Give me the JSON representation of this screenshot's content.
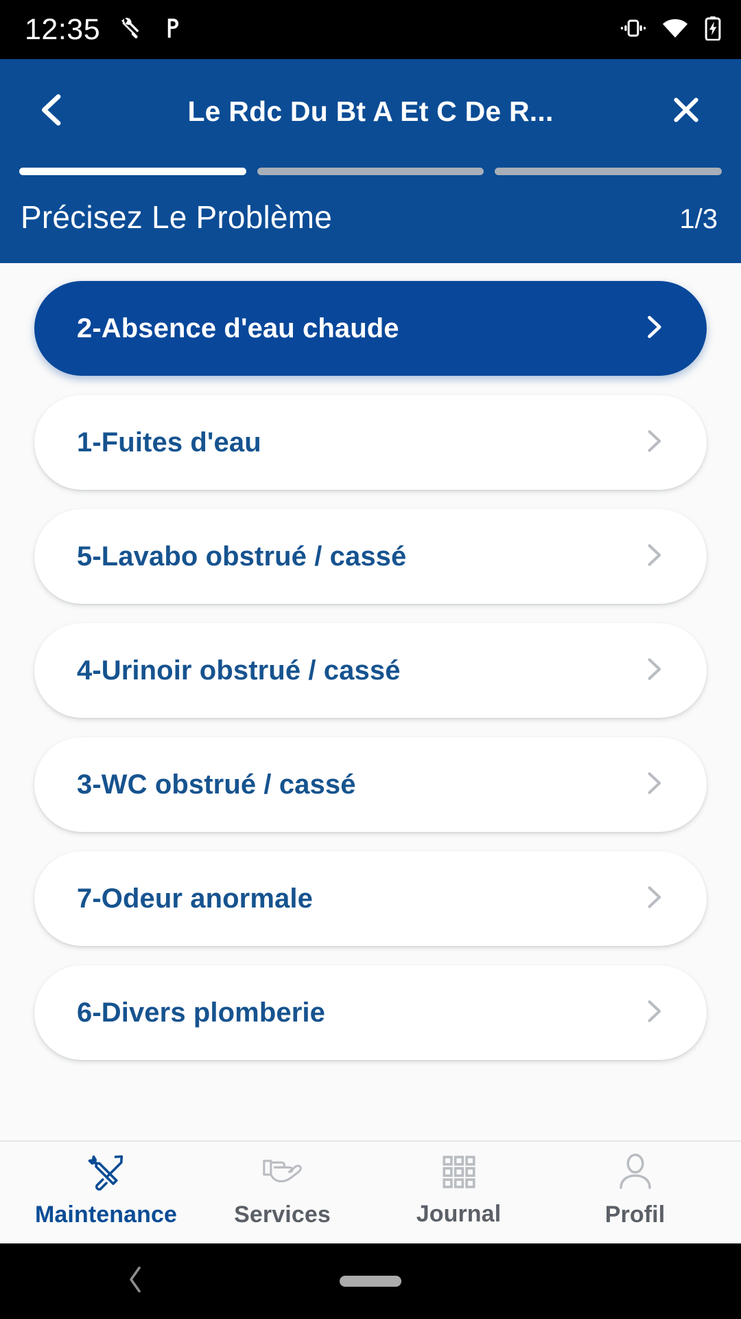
{
  "status_bar": {
    "clock": "12:35",
    "left_icons": [
      "wrench-icon",
      "parking-p-icon"
    ],
    "right_icons": [
      "vibrate-icon",
      "wifi-icon",
      "battery-charging-icon"
    ]
  },
  "header": {
    "back_icon": "chevron-left-icon",
    "title": "Le Rdc Du Bt A Et C De R...",
    "close_icon": "close-icon",
    "step_label": "Précisez Le Problème",
    "step_count": "1/3",
    "progress": {
      "total": 3,
      "current": 1
    },
    "background_color": "#0B4C95"
  },
  "problem_list": {
    "items": [
      {
        "label": "2-Absence d'eau chaude",
        "selected": true,
        "chevron": "chevron-right-icon"
      },
      {
        "label": "1-Fuites d'eau",
        "selected": false,
        "chevron": "chevron-right-icon"
      },
      {
        "label": "5-Lavabo obstrué / cassé",
        "selected": false,
        "chevron": "chevron-right-icon"
      },
      {
        "label": "4-Urinoir obstrué / cassé",
        "selected": false,
        "chevron": "chevron-right-icon"
      },
      {
        "label": "3-WC obstrué / cassé",
        "selected": false,
        "chevron": "chevron-right-icon"
      },
      {
        "label": "7-Odeur anormale",
        "selected": false,
        "chevron": "chevron-right-icon"
      },
      {
        "label": "6-Divers plomberie",
        "selected": false,
        "chevron": "chevron-right-icon"
      }
    ],
    "selected_color": "#08479A",
    "item_text_color": "#16538F"
  },
  "bottom_nav": {
    "items": [
      {
        "label": "Maintenance",
        "icon": "tools-icon",
        "active": true
      },
      {
        "label": "Services",
        "icon": "hand-icon",
        "active": false
      },
      {
        "label": "Journal",
        "icon": "grid-icon",
        "active": false
      },
      {
        "label": "Profil",
        "icon": "person-icon",
        "active": false
      }
    ],
    "active_color": "#0B4C95",
    "inactive_color": "#5B6067"
  },
  "android_nav": {
    "back_icon": "android-back-icon",
    "home_icon": "android-home-pill"
  }
}
